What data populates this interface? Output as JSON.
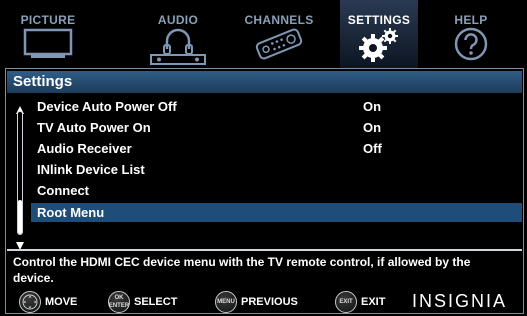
{
  "tabs": [
    {
      "label": "PICTURE",
      "icon": "tv-icon",
      "active": false
    },
    {
      "label": "AUDIO",
      "icon": "headphones-icon",
      "active": false
    },
    {
      "label": "CHANNELS",
      "icon": "remote-icon",
      "active": false
    },
    {
      "label": "SETTINGS",
      "icon": "gears-icon",
      "active": true
    },
    {
      "label": "HELP",
      "icon": "question-icon",
      "active": false
    }
  ],
  "panel": {
    "title": "Settings",
    "items": [
      {
        "label": "Device Auto Power Off",
        "value": "On"
      },
      {
        "label": "TV Auto Power On",
        "value": "On"
      },
      {
        "label": "Audio Receiver",
        "value": "Off"
      },
      {
        "label": "INlink Device List",
        "value": ""
      },
      {
        "label": "Connect",
        "value": ""
      },
      {
        "label": "Root Menu",
        "value": "",
        "selected": true
      }
    ],
    "help": "Control the HDMI CEC device menu with the TV remote control, if allowed by the device."
  },
  "nav": {
    "move": "MOVE",
    "select": "SELECT",
    "select_btn_top": "OK",
    "select_btn_bottom": "ENTER",
    "previous": "PREVIOUS",
    "previous_btn": "MENU",
    "exit": "EXIT",
    "exit_btn": "EXIT"
  },
  "brand": "INSIGNIA",
  "colors": {
    "selected_row": "#1f4d7a",
    "title_bar": "#2f5d86",
    "inactive_tab_text": "#8a9fb8"
  }
}
